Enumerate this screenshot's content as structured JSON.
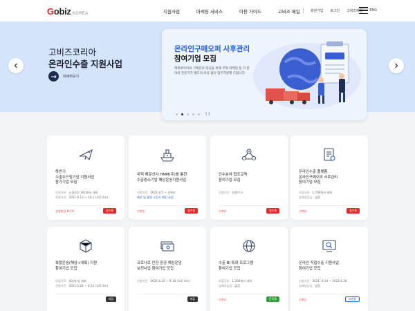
{
  "header": {
    "logo_main": "obiz",
    "logo_g": "G",
    "logo_sub": "KOREA",
    "nav": [
      "지원사업",
      "마케팅 서비스",
      "이용 가이드",
      "고비즈 메일"
    ],
    "util": [
      "회원가입",
      "로그인",
      "고비즈메일",
      "ENG"
    ]
  },
  "hero": {
    "title_line1": "고비즈코리아",
    "title_line2": "온라인수출 지원사업",
    "more_label": "자세히보기",
    "banner": {
      "title_highlight": "온라인구매오퍼 사후관리",
      "title_line2": "참여기업 모집",
      "desc": "해외바이어의 구매문의 대응을 위해 무역·마케팅 등 각 분야의 전문가가 밸도의 비용 없이 업무지원해 드립니다."
    }
  },
  "cards": [
    {
      "icon": "airplane-icon",
      "title": [
        "하반기",
        "수출두드림기업 지원사업",
        "참가기업 모집"
      ],
      "meta": [
        {
          "label": "모집규모",
          "value": "소상공인 30(개사) 내외",
          "highlight": false
        },
        {
          "label": "신청기간",
          "value": "2021.9.13 ~ 10.1 (오후 6시)",
          "highlight": false
        }
      ],
      "bottom": "신청마감 D-10",
      "badge": "접수중",
      "badge_color": "red"
    },
    {
      "icon": "ship-icon",
      "title": [
        "국적 해운선사 HMM(주)를 통한",
        "수출중소기업 해상운송지원사업"
      ],
      "meta": [
        {
          "label": "신청기간",
          "value": "2021.8.5 ~ 선착순",
          "highlight": false
        },
        {
          "label": "",
          "value": "예산 및 물량 소진시 확인 요망",
          "highlight": true
        }
      ],
      "bottom": "선착순",
      "badge": "접수중",
      "badge_color": "red"
    },
    {
      "icon": "network-icon",
      "title": [
        "인수분야 협조교역",
        "참여기업 모집"
      ],
      "meta": [
        {
          "label": "신청기간",
          "value": "연중수시",
          "highlight": false
        }
      ],
      "bottom": "선착순",
      "badge": "접수중",
      "badge_color": "red"
    },
    {
      "icon": "document-icon",
      "title": [
        "온라인수출 플랫폼",
        "온라인구매오퍼 사후관리",
        "참여기업 모집"
      ],
      "meta": [
        {
          "label": "모집규모",
          "value": "1,700개사 내외",
          "highlight": false
        },
        {
          "label": "업체부담금",
          "value": "없음",
          "highlight": false
        }
      ],
      "bottom": "선착순",
      "badge": "접수중",
      "badge_color": "red"
    },
    {
      "icon": "box-icon",
      "title": [
        "복합운송(해상+내륙) 지원",
        "참여기업 모집"
      ],
      "meta": [
        {
          "label": "모집규모",
          "value": "40(개사) 내외",
          "highlight": false
        },
        {
          "label": "신청기간",
          "value": "2021.5.24 ~ 6.11 (오후 6시)",
          "highlight": false
        }
      ],
      "bottom": "",
      "badge": "마감",
      "badge_color": "dark"
    },
    {
      "icon": "money-icon",
      "title": [
        "코로나로 인한 항공·해상운임",
        "보전사업 참여기업 모집"
      ],
      "meta": [
        {
          "label": "신청기간",
          "value": "2021.8.30 ~ 9.10 (오후 6시)",
          "highlight": false
        }
      ],
      "bottom": "",
      "badge": "마감",
      "badge_color": "dark"
    },
    {
      "icon": "globe-icon",
      "title": [
        "수출 BI 특화 프로그램",
        "참여기업 모집"
      ],
      "meta": [
        {
          "label": "모집규모",
          "value": "1,300개사 내외",
          "highlight": false
        },
        {
          "label": "업체부담금",
          "value": "없음",
          "highlight": false
        }
      ],
      "bottom": "선착순",
      "badge": "준비중",
      "badge_color": "green"
    },
    {
      "icon": "search-icon",
      "title": [
        "온라인 직접수출 지원사업",
        "참여기업 모집"
      ],
      "meta": [
        {
          "label": "신청기간",
          "value": "2021. 6.14 ~ 2021.6.28",
          "highlight": false
        },
        {
          "label": "업체부담금",
          "value": "없음",
          "highlight": false
        }
      ],
      "bottom": "선착순",
      "badge": "지원중",
      "badge_color": "blue"
    }
  ]
}
